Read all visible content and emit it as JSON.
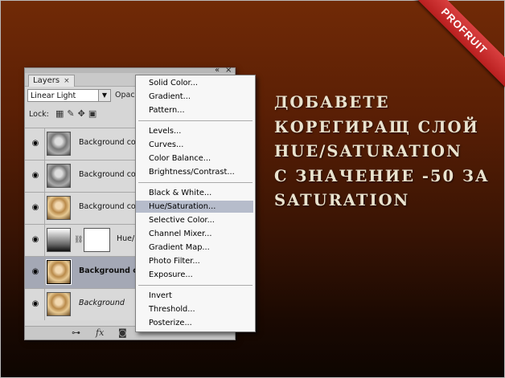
{
  "headline": [
    "ДОБАВЕТЕ",
    "КОРЕГИРАЩ СЛОЙ",
    "HUE/SATURATION",
    "С ЗНАЧЕНИЕ -50 ЗА",
    "SATURATION"
  ],
  "ribbon": {
    "label": "PROFRUIT"
  },
  "panel": {
    "tab_label": "Layers",
    "tab_close": "×",
    "ctrl_collapse": "«",
    "ctrl_close": "×",
    "blend_mode": "Linear Light",
    "opacity_label": "Opac",
    "lock_label": "Lock:",
    "layers": [
      {
        "name": "Background co",
        "thumb": "gray",
        "style": "normal"
      },
      {
        "name": "Background co",
        "thumb": "gray",
        "style": "normal"
      },
      {
        "name": "Background co",
        "thumb": "color",
        "style": "normal"
      },
      {
        "name": "Hue/",
        "thumb": "grad",
        "style": "adjust"
      },
      {
        "name": "Background c",
        "thumb": "color",
        "style": "bold"
      },
      {
        "name": "Background",
        "thumb": "color",
        "style": "italic"
      }
    ],
    "footer_fx": "fx"
  },
  "menu": {
    "groups": [
      [
        "Solid Color...",
        "Gradient...",
        "Pattern..."
      ],
      [
        "Levels...",
        "Curves...",
        "Color Balance...",
        "Brightness/Contrast..."
      ],
      [
        "Black & White...",
        "Hue/Saturation...",
        "Selective Color...",
        "Channel Mixer...",
        "Gradient Map...",
        "Photo Filter...",
        "Exposure..."
      ],
      [
        "Invert",
        "Threshold...",
        "Posterize..."
      ]
    ],
    "highlighted": "Hue/Saturation..."
  }
}
